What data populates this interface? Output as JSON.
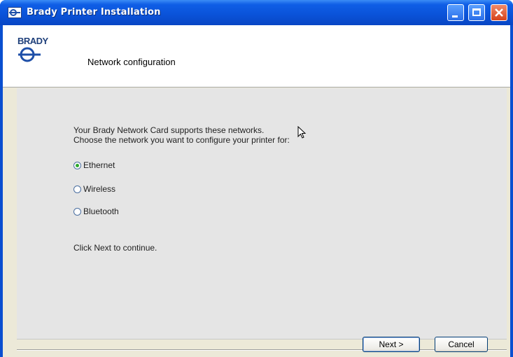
{
  "window": {
    "title": "Brady Printer Installation"
  },
  "header": {
    "logo_text": "BRADY",
    "title": "Network configuration"
  },
  "content": {
    "intro_line1": "Your Brady Network Card supports these networks.",
    "intro_line2": "Choose  the network you want to configure your printer for:",
    "options": [
      {
        "label": "Ethernet",
        "checked": true
      },
      {
        "label": "Wireless",
        "checked": false
      },
      {
        "label": "Bluetooth",
        "checked": false
      }
    ],
    "continue_text": "Click Next to continue."
  },
  "buttons": {
    "next_label": "Next >",
    "cancel_label": "Cancel"
  }
}
